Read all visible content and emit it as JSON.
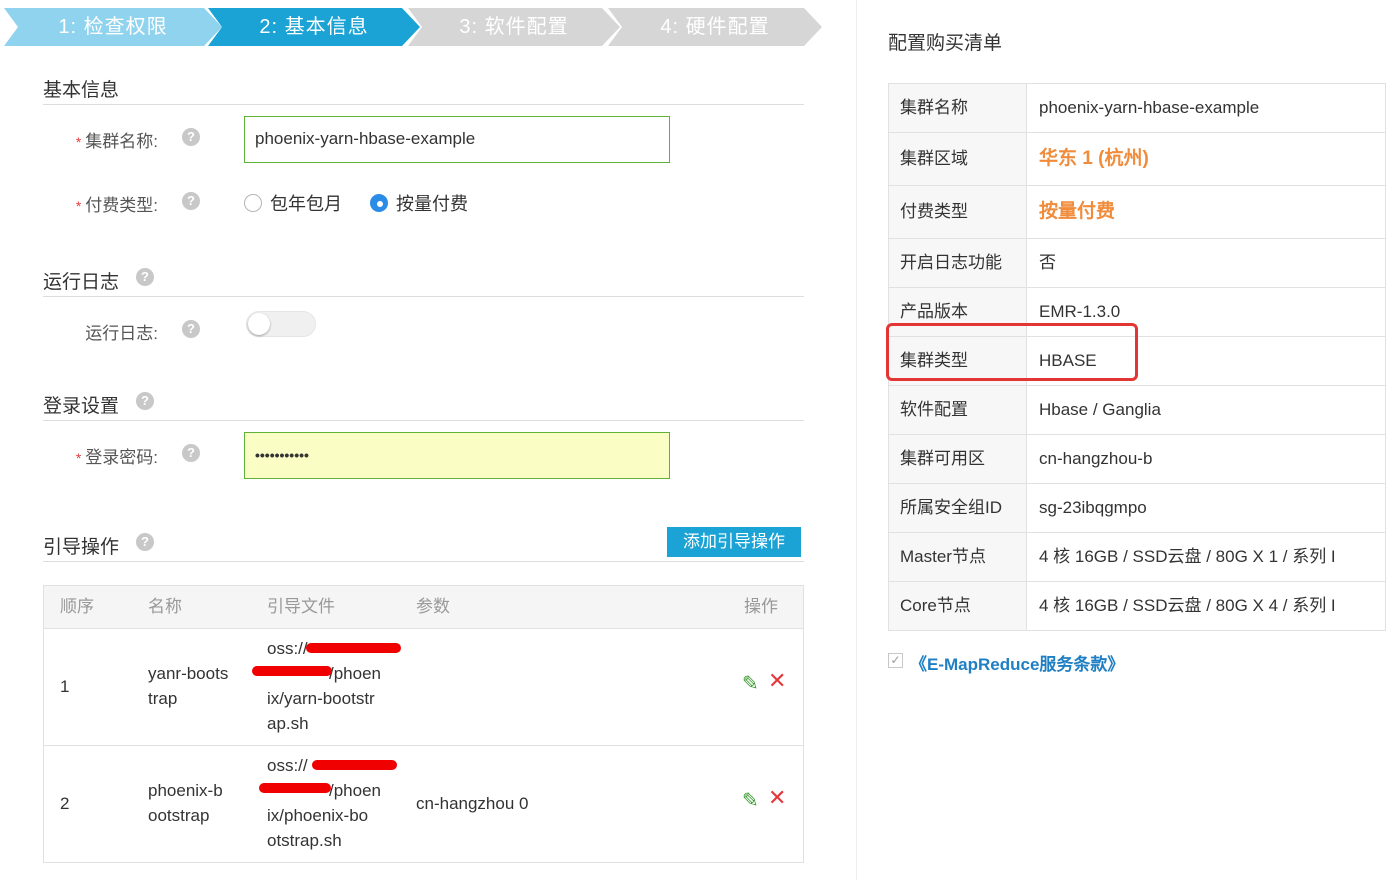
{
  "steps": [
    {
      "label": "1:  检查权限",
      "color": "#8fd3ee"
    },
    {
      "label": "2:  基本信息",
      "color": "#1aa3d4"
    },
    {
      "label": "3:  软件配置",
      "color": "#d6d6d6"
    },
    {
      "label": "4:  硬件配置",
      "color": "#d6d6d6"
    }
  ],
  "basic": {
    "title": "基本信息",
    "cluster_name_label": "集群名称:",
    "cluster_name_value": "phoenix-yarn-hbase-example",
    "pay_type_label": "付费类型:",
    "pay_options": [
      "包年包月",
      "按量付费"
    ],
    "pay_selected": "按量付费"
  },
  "log": {
    "title": "运行日志",
    "label": "运行日志:",
    "enabled": false
  },
  "login": {
    "title": "登录设置",
    "password_label": "登录密码:",
    "password_value": "•••••••••••"
  },
  "bootstrap": {
    "title": "引导操作",
    "add_button": "添加引导操作",
    "headers": [
      "顺序",
      "名称",
      "引导文件",
      "参数",
      "操作"
    ],
    "rows": [
      {
        "order": "1",
        "name_lines": [
          "yanr-boots",
          "trap"
        ],
        "file_lines": [
          "oss://",
          "/phoen",
          "ix/yarn-bootstr",
          "ap.sh"
        ],
        "params": ""
      },
      {
        "order": "2",
        "name_lines": [
          "phoenix-b",
          "ootstrap"
        ],
        "file_lines": [
          "oss://",
          "/phoen",
          "ix/phoenix-bo",
          "otstrap.sh"
        ],
        "params": "cn-hangzhou 0"
      }
    ]
  },
  "summary": {
    "title": "配置购买清单",
    "rows": [
      {
        "key": "集群名称",
        "value": "phoenix-yarn-hbase-example",
        "style": "normal"
      },
      {
        "key": "集群区域",
        "value": "华东 1 (杭州)",
        "style": "orange"
      },
      {
        "key": "付费类型",
        "value": "按量付费",
        "style": "orange"
      },
      {
        "key": "开启日志功能",
        "value": "否",
        "style": "normal"
      },
      {
        "key": "产品版本",
        "value": "EMR-1.3.0",
        "style": "normal"
      },
      {
        "key": "集群类型",
        "value": "HBASE",
        "style": "normal"
      },
      {
        "key": "软件配置",
        "value": "Hbase / Ganglia",
        "style": "normal"
      },
      {
        "key": "集群可用区",
        "value": "cn-hangzhou-b",
        "style": "normal"
      },
      {
        "key": "所属安全组ID",
        "value": "sg-23ibqgmpo",
        "style": "normal"
      },
      {
        "key": "Master节点",
        "value": "4 核 16GB / SSD云盘 / 80G X 1 / 系列 I",
        "style": "normal"
      },
      {
        "key": "Core节点",
        "value": "4 核 16GB / SSD云盘 / 80G X 4 / 系列 I",
        "style": "normal"
      }
    ],
    "terms_checked": true,
    "terms_link": "《E-MapReduce服务条款》"
  },
  "icons": {
    "help": "question-circle-icon",
    "edit": "pencil-icon",
    "delete": "close-icon",
    "check": "check-icon"
  },
  "colors": {
    "accent": "#1aa3d4",
    "success_border": "#5fb236",
    "highlight": "#e43535",
    "orange": "#f08c3b",
    "link": "#1f7fc4"
  }
}
